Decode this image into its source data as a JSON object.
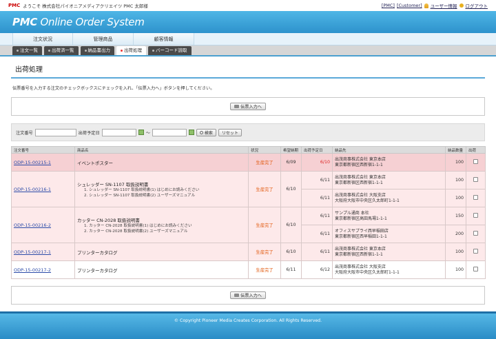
{
  "topbar": {
    "logo_text": "PMC",
    "greeting": "ようこそ 株式会社パイオニアメディアクリエイツ PMC 太郎様",
    "link_pmc": "[PMC]",
    "link_customer": "[Customer]",
    "user_info": "ユーザー情報",
    "logout": "ログアウト"
  },
  "header": {
    "logo_brand": "PMC",
    "logo_rest": "Online Order System"
  },
  "mainnav": [
    "注文状況",
    "管理商品",
    "顧客情報"
  ],
  "subnav": [
    "注文一覧",
    "出荷済一覧",
    "納品書出力",
    "出荷処理",
    "バーコード読取"
  ],
  "page": {
    "title": "出荷処理",
    "instruction": "伝票番号を入力する注文のチェックボックスにチェックを入れ、「伝票入力へ」ボタンを押してください。",
    "slip_button": "伝票入力へ"
  },
  "search": {
    "order_label": "注文番号",
    "ship_date_label": "出荷予定日",
    "tilde": "～",
    "search_btn": "検索",
    "reset_btn": "リセット"
  },
  "table": {
    "headers": [
      "注文番号",
      "商品名",
      "状況",
      "希望納期",
      "出荷予定日",
      "納品先",
      "納品数量",
      "出荷"
    ],
    "rows": [
      {
        "order": "ODP-15-00215-1",
        "product": "イベントポスター",
        "subs": [],
        "status": "生産完了",
        "desired": "6/09",
        "ship": [
          "6/10"
        ],
        "dest": [
          [
            "出茂商事株式会社 東京本店",
            "東京都新宿区西新宿1-1-1"
          ]
        ],
        "qty": [
          "100"
        ]
      },
      {
        "order": "ODP-15-00216-1",
        "product": "シュレッダー SN-1107 取扱説明書",
        "subs": [
          "1. シュレッダー SN-1107 取扱説明書(1) はじめにお読みください",
          "2. シュレッダー SN-1107 取扱説明書(2) ユーザーズマニュアル"
        ],
        "status": "生産完了",
        "desired": "6/10",
        "ship": [
          "6/11",
          "6/11"
        ],
        "dest": [
          [
            "出茂商事株式会社 東京本店",
            "東京都新宿区西新宿1-1-1"
          ],
          [
            "出茂商事株式会社 大阪支店",
            "大阪府大阪市中央区久太郎町1-1-1"
          ]
        ],
        "qty": [
          "100",
          "100"
        ]
      },
      {
        "order": "ODP-15-00216-2",
        "product": "カッター CN-2028 取扱説明書",
        "subs": [
          "1. カッター CN-2028 取扱説明書(1) はじめにお読みください",
          "2. カッター CN-2028 取扱説明書(2) ユーザーズマニュアル"
        ],
        "status": "生産完了",
        "desired": "6/10",
        "ship": [
          "6/11",
          "6/11"
        ],
        "dest": [
          [
            "サンプル通商 本社",
            "東京都新宿区高田馬場1-1-1"
          ],
          [
            "オフィスサプライ西早稲田店",
            "東京都新宿区西早稲田1-1-1"
          ]
        ],
        "qty": [
          "150",
          "200"
        ]
      },
      {
        "order": "ODP-15-00217-1",
        "product": "プリンターカタログ",
        "subs": [],
        "status": "生産完了",
        "desired": "6/10",
        "ship": [
          "6/11"
        ],
        "dest": [
          [
            "出茂商事株式会社 東京本店",
            "東京都新宿区西新宿1-1-1"
          ]
        ],
        "qty": [
          "100"
        ]
      },
      {
        "order": "ODP-15-00217-2",
        "product": "プリンターカタログ",
        "subs": [],
        "status": "生産完了",
        "desired": "6/11",
        "ship": [
          "6/12"
        ],
        "dest": [
          [
            "出茂商事株式会社 大阪支店",
            "大阪府大阪市中央区久太郎町1-1-1"
          ]
        ],
        "qty": [
          "100"
        ]
      }
    ]
  },
  "footer": {
    "copyright": "© Copyright Pioneer Media Creates Corporation. All Rights Reserved."
  },
  "colors": {
    "header_blue": "#2d92cc",
    "status_orange": "#e25a10",
    "highlight_pink": "#f6d0d3",
    "late_red": "#d22222"
  }
}
